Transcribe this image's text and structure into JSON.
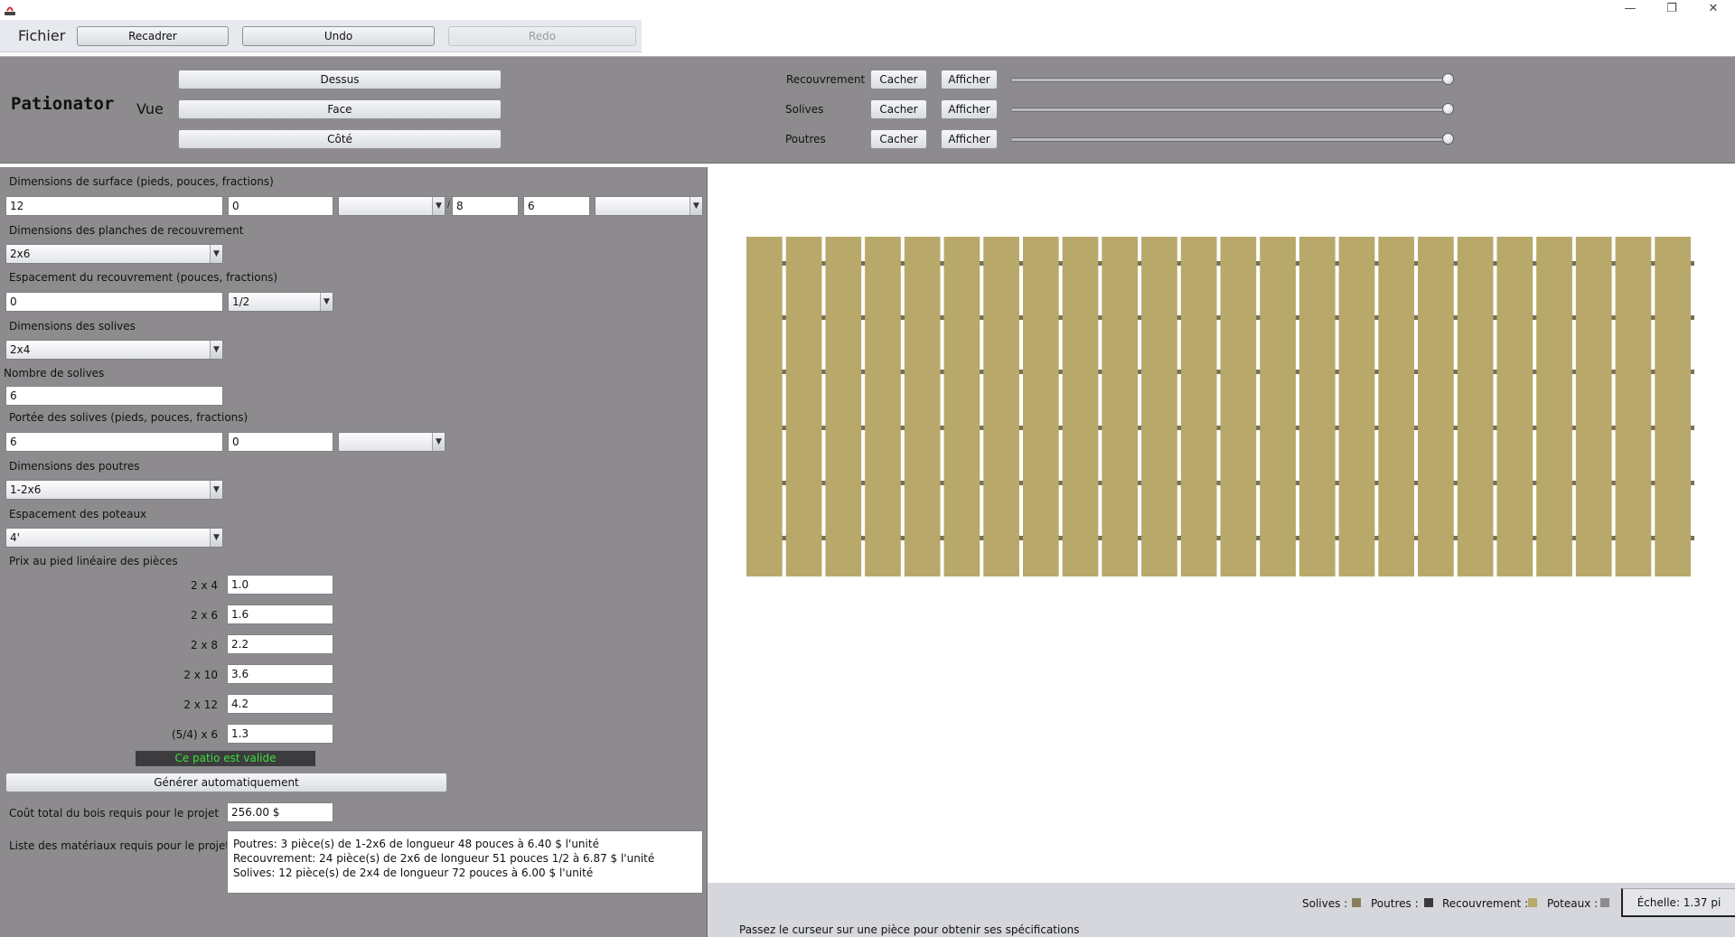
{
  "menu": {
    "fichier": "Fichier"
  },
  "toolbar": {
    "recadrer": "Recadrer",
    "undo": "Undo",
    "redo": "Redo"
  },
  "header": {
    "logo": "Pationator",
    "vue_label": "Vue",
    "views": {
      "dessus": "Dessus",
      "face": "Face",
      "cote": "Côté"
    },
    "layers": [
      {
        "label": "Recouvrement",
        "hide": "Cacher",
        "show": "Afficher",
        "value": 1.0
      },
      {
        "label": "Solives",
        "hide": "Cacher",
        "show": "Afficher",
        "value": 1.0
      },
      {
        "label": "Poutres",
        "hide": "Cacher",
        "show": "Afficher",
        "value": 1.0
      }
    ]
  },
  "form": {
    "surface_label": "Dimensions de surface (pieds, pouces, fractions)",
    "surface_feet_1": "12",
    "surface_inches_1": "0",
    "surface_fraction_1": "",
    "surface_sep": "/",
    "surface_feet_2": "8",
    "surface_inches_2": "6",
    "surface_fraction_2": "",
    "planches_label": "Dimensions des planches de recouvrement",
    "planches_value": "2x6",
    "espacement_rec_label": "Espacement du recouvrement (pouces, fractions)",
    "espacement_rec_inches": "0",
    "espacement_rec_fraction": "1/2",
    "solives_dim_label": "Dimensions des solives",
    "solives_dim_value": "2x4",
    "nb_solives_label": "Nombre de solives",
    "nb_solives_value": "6",
    "portee_label": "Portée des solives (pieds, pouces, fractions)",
    "portee_feet": "6",
    "portee_inches": "0",
    "portee_fraction": "",
    "poutres_dim_label": "Dimensions des poutres",
    "poutres_dim_value": "1-2x6",
    "poteaux_label": "Espacement des poteaux",
    "poteaux_value": "4'",
    "prix_label": "Prix au pied linéaire des pièces",
    "prices": [
      {
        "label": "2 x 4",
        "value": "1.0"
      },
      {
        "label": "2 x 6",
        "value": "1.6"
      },
      {
        "label": "2 x 8",
        "value": "2.2"
      },
      {
        "label": "2 x 10",
        "value": "3.6"
      },
      {
        "label": "2 x 12",
        "value": "4.2"
      },
      {
        "label": "(5/4) x 6",
        "value": "1.3"
      }
    ],
    "valid_status": "Ce patio est valide",
    "generate_button": "Générer automatiquement",
    "cout_label": "Coût total du bois requis pour le projet",
    "cout_value": "256.00 $",
    "materiaux_label": "Liste des matériaux requis pour le projet",
    "materiaux": [
      "Poutres: 3 pièce(s) de 1-2x6 de longueur  48 pouces  à 6.40 $ l'unité",
      "Recouvrement: 24 pièce(s) de 2x6 de longueur  51 pouces 1/2 à 6.87 $ l'unité",
      "Solives: 12 pièce(s) de 2x4 de longueur  72 pouces  à 6.00 $ l'unité"
    ]
  },
  "deck": {
    "board_count": 24,
    "board_color": "#b8a96b",
    "joist_color": "#7a6f55",
    "beam_color": "#3a3a3a"
  },
  "legend": {
    "solives": "Solives :",
    "solives_color": "#8a7f5c",
    "poutres": "Poutres :",
    "poutres_color": "#3b3b3b",
    "recouvrement": "Recouvrement :",
    "recouvrement_color": "#b8a96b",
    "poteaux": "Poteaux :",
    "poteaux_color": "#8d8b8e",
    "scale": "Échelle: 1.37 pi"
  },
  "status": {
    "hint": "Passez le curseur sur une pièce pour obtenir ses spécifications"
  }
}
